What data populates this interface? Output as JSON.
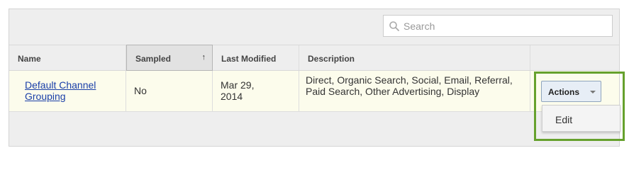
{
  "search": {
    "placeholder": "Search",
    "value": ""
  },
  "table": {
    "columns": [
      "Name",
      "Sampled",
      "Last Modified",
      "Description"
    ],
    "sort": {
      "column": "Sampled",
      "arrow": "↑"
    },
    "rows": [
      {
        "name": "Default Channel Grouping",
        "sampled": "No",
        "last_modified": "Mar 29, 2014",
        "description": "Direct, Organic Search, Social, Email, Referral, Paid Search, Other Advertising, Display"
      }
    ]
  },
  "actions": {
    "button_label": "Actions",
    "menu_items": [
      "Edit"
    ]
  },
  "colors": {
    "highlight": "#66a12d",
    "row_background": "#fcfcec",
    "link": "#1a3fa8"
  }
}
